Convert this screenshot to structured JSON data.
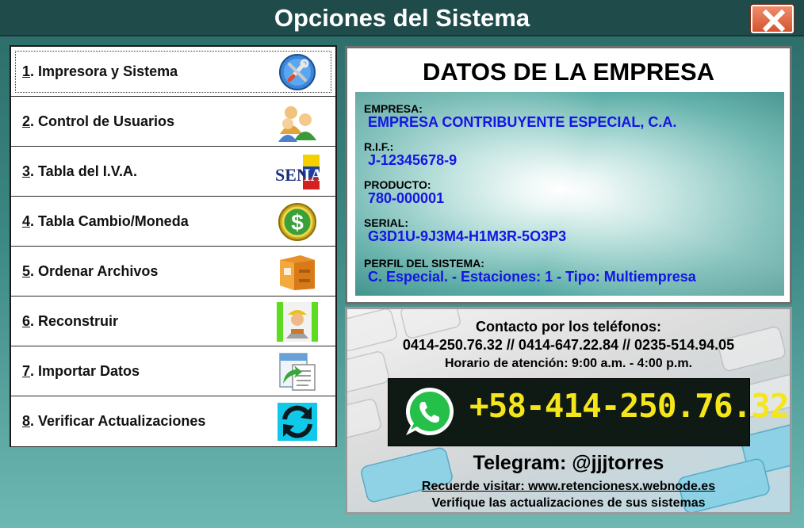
{
  "window": {
    "title": "Opciones del Sistema",
    "close_icon": "close-icon"
  },
  "menu": {
    "items": [
      {
        "num": "1",
        "label": ". Impresora y Sistema",
        "icon": "tools-icon"
      },
      {
        "num": "2",
        "label": ". Control de Usuarios",
        "icon": "users-icon"
      },
      {
        "num": "3",
        "label": ". Tabla del I.V.A.",
        "icon": "seniat-logo-icon"
      },
      {
        "num": "4",
        "label": ". Tabla Cambio/Moneda",
        "icon": "dollar-coin-icon"
      },
      {
        "num": "5",
        "label": ". Ordenar Archivos",
        "icon": "file-drawer-icon"
      },
      {
        "num": "6",
        "label": ". Reconstruir",
        "icon": "worker-icon"
      },
      {
        "num": "7",
        "label": ". Importar Datos",
        "icon": "import-data-icon"
      },
      {
        "num": "8",
        "label": ". Verificar Actualizaciones",
        "icon": "refresh-icon"
      }
    ],
    "selected_index": 0
  },
  "company": {
    "heading": "DATOS DE LA EMPRESA",
    "fields": [
      {
        "label": "EMPRESA:",
        "value": "EMPRESA CONTRIBUYENTE ESPECIAL, C.A."
      },
      {
        "label": "R.I.F.:",
        "value": "J-12345678-9"
      },
      {
        "label": "PRODUCTO:",
        "value": "780-000001"
      },
      {
        "label": "SERIAL:",
        "value": "G3D1U-9J3M4-H1M3R-5O3P3"
      },
      {
        "label": "PERFIL DEL SISTEMA:",
        "value": "C. Especial. - Estaciones: 1 - Tipo: Multiempresa"
      }
    ]
  },
  "contact": {
    "heading": "Contacto por los teléfonos:",
    "phones": "0414-250.76.32 // 0414-647.22.84 // 0235-514.94.05",
    "hours": "Horario de atención: 9:00 a.m. - 4:00 p.m.",
    "whatsapp": "+58-414-250.76.32",
    "whatsapp_icon": "whatsapp-icon",
    "telegram": "Telegram: @jjjtorres",
    "visit": "Recuerde visitar: www.retencionesx.webnode.es",
    "updates": "Verifique las actualizaciones de sus sistemas"
  },
  "colors": {
    "title_bar": "#1f4c4a",
    "value_blue": "#1414e6",
    "whatsapp_text": "#f4e61a",
    "whatsapp_green": "#25c04a"
  }
}
